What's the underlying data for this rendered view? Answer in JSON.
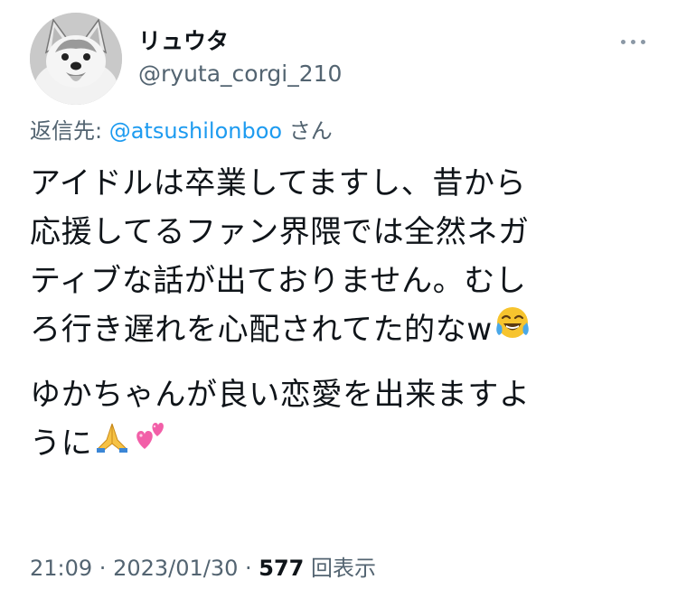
{
  "author": {
    "display_name": "リュウタ",
    "handle": "@ryuta_corgi_210"
  },
  "reply": {
    "prefix": "返信先: ",
    "mention": "@atsushilonboo",
    "suffix": " さん"
  },
  "tweet": {
    "lines": [
      "アイドルは卒業してますし、昔から",
      "応援してるファン界隈では全然ネガ",
      "ティブな話が出ておりません。むし",
      "ろ行き遅れを心配されてた的なw"
    ],
    "lines2": [
      "ゆかちゃんが良い恋愛を出来ますよ",
      "うに"
    ],
    "emojis": {
      "laughing": "face-with-tears-of-joy-icon",
      "pray": "folded-hands-icon",
      "hearts": "two-hearts-icon"
    }
  },
  "meta": {
    "time": "21:09",
    "sep1": " · ",
    "date": "2023/01/30",
    "sep2": " · ",
    "views": "577",
    "views_label": " 回表示"
  },
  "colors": {
    "text": "#0f1419",
    "secondary": "#536471",
    "link": "#1d9bf0"
  }
}
